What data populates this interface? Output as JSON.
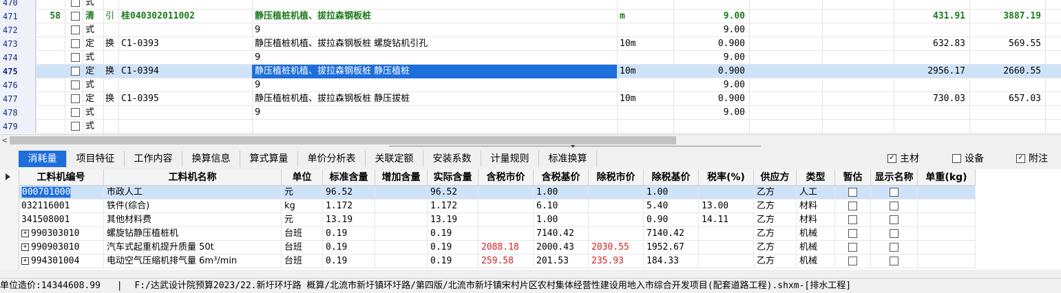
{
  "upper_rows": [
    {
      "num": "470",
      "seq": "",
      "type": "式",
      "huan": "",
      "code": "",
      "name": "",
      "unit": "",
      "qty": "",
      "price": "",
      "total": ""
    },
    {
      "num": "471",
      "seq": "58",
      "type": "清",
      "huan": "引",
      "code": "桂040302011002",
      "name": "静压植桩机植、拔拉森钢板桩",
      "unit": "m",
      "qty": "9.00",
      "price": "431.91",
      "total": "3887.19"
    },
    {
      "num": "472",
      "seq": "",
      "type": "式",
      "huan": "",
      "code": "",
      "name": "9",
      "unit": "",
      "qty": "9.00",
      "price": "",
      "total": ""
    },
    {
      "num": "473",
      "seq": "",
      "type": "定",
      "huan": "换",
      "code": "C1-0393",
      "name": "静压植桩机植、拔拉森钢板桩 螺旋钻机引孔",
      "unit": "10m",
      "qty": "0.900",
      "price": "632.83",
      "total": "569.55"
    },
    {
      "num": "474",
      "seq": "",
      "type": "式",
      "huan": "",
      "code": "",
      "name": "9",
      "unit": "",
      "qty": "9.00",
      "price": "",
      "total": ""
    },
    {
      "num": "475",
      "seq": "",
      "type": "定",
      "huan": "换",
      "code": "C1-0394",
      "name": "静压植桩机植、拔拉森钢板桩 静压植桩",
      "unit": "10m",
      "qty": "0.900",
      "price": "2956.17",
      "total": "2660.55"
    },
    {
      "num": "476",
      "seq": "",
      "type": "式",
      "huan": "",
      "code": "",
      "name": "9",
      "unit": "",
      "qty": "9.00",
      "price": "",
      "total": ""
    },
    {
      "num": "477",
      "seq": "",
      "type": "定",
      "huan": "换",
      "code": "C1-0395",
      "name": "静压植桩机植、拔拉森钢板桩 静压拔桩",
      "unit": "10m",
      "qty": "0.900",
      "price": "730.03",
      "total": "657.03"
    },
    {
      "num": "478",
      "seq": "",
      "type": "式",
      "huan": "",
      "code": "",
      "name": "9",
      "unit": "",
      "qty": "9.00",
      "price": "",
      "total": ""
    },
    {
      "num": "479",
      "seq": "",
      "type": "式",
      "huan": "",
      "code": "",
      "name": "",
      "unit": "",
      "qty": "",
      "price": "",
      "total": ""
    }
  ],
  "scroll_left_arrow": "<",
  "tabs": [
    "消耗量",
    "项目特征",
    "工作内容",
    "换算信息",
    "算式算量",
    "单价分析表",
    "关联定额",
    "安装系数",
    "计量规则",
    "标准换算"
  ],
  "checks": [
    {
      "label": "主材",
      "checked": true
    },
    {
      "label": "设备",
      "checked": false
    },
    {
      "label": "附注",
      "checked": true
    }
  ],
  "lower_headers": [
    "工料机编号",
    "工料机名称",
    "单位",
    "标准含量",
    "增加含量",
    "实际含量",
    "含税市价",
    "含税基价",
    "除税市价",
    "除税基价",
    "税率(%)",
    "供应方",
    "类型",
    "暂估",
    "显示名称",
    "单重(kg)"
  ],
  "lower_rows": [
    {
      "code": "000701000",
      "name": "市政人工",
      "unit": "元",
      "std": "96.52",
      "add": "",
      "actual": "96.52",
      "tax_mkt": "",
      "tax_base": "1.00",
      "notax_mkt": "",
      "notax_base": "1.00",
      "rate": "",
      "supplier": "乙方",
      "kind": "人工",
      "plus": false
    },
    {
      "code": "032116001",
      "name": "铁件(综合)",
      "unit": "kg",
      "std": "1.172",
      "add": "",
      "actual": "1.172",
      "tax_mkt": "",
      "tax_base": "6.10",
      "notax_mkt": "",
      "notax_base": "5.40",
      "rate": "13.00",
      "supplier": "乙方",
      "kind": "材料",
      "plus": false
    },
    {
      "code": "341508001",
      "name": "其他材料费",
      "unit": "元",
      "std": "13.19",
      "add": "",
      "actual": "13.19",
      "tax_mkt": "",
      "tax_base": "1.00",
      "notax_mkt": "",
      "notax_base": "0.90",
      "rate": "14.11",
      "supplier": "乙方",
      "kind": "材料",
      "plus": false
    },
    {
      "code": "990303010",
      "name": "螺旋钻静压植桩机",
      "unit": "台班",
      "std": "0.19",
      "add": "",
      "actual": "0.19",
      "tax_mkt": "",
      "tax_base": "7140.42",
      "notax_mkt": "",
      "notax_base": "7140.42",
      "rate": "",
      "supplier": "乙方",
      "kind": "机械",
      "plus": true
    },
    {
      "code": "990903010",
      "name": "汽车式起重机提升质量 50t",
      "unit": "台班",
      "std": "0.19",
      "add": "",
      "actual": "0.19",
      "tax_mkt": "2088.18",
      "tax_base": "2000.43",
      "notax_mkt": "2030.55",
      "notax_base": "1952.67",
      "rate": "",
      "supplier": "乙方",
      "kind": "机械",
      "plus": true
    },
    {
      "code": "994301004",
      "name": "电动空气压缩机排气量 6m³/min",
      "unit": "台班",
      "std": "0.19",
      "add": "",
      "actual": "0.19",
      "tax_mkt": "259.58",
      "tax_base": "201.53",
      "notax_mkt": "235.93",
      "notax_base": "184.33",
      "rate": "",
      "supplier": "乙方",
      "kind": "机械",
      "plus": true
    }
  ],
  "status": {
    "cost": "单位造价:14344608.99",
    "sep": "|",
    "path": "F:/达武设计院预算2023/22.新圩环圩路 概算/北流市新圩镇环圩路/第四版/北流市新圩镇宋村片区农村集体经营性建设用地入市综合开发项目(配套道路工程).shxm-[排水工程]"
  },
  "colors": {
    "accent": "#1e6fd9",
    "selected_row": "#cfe3f8",
    "green_text": "#1a7a1a",
    "red_text": "#d42020"
  }
}
